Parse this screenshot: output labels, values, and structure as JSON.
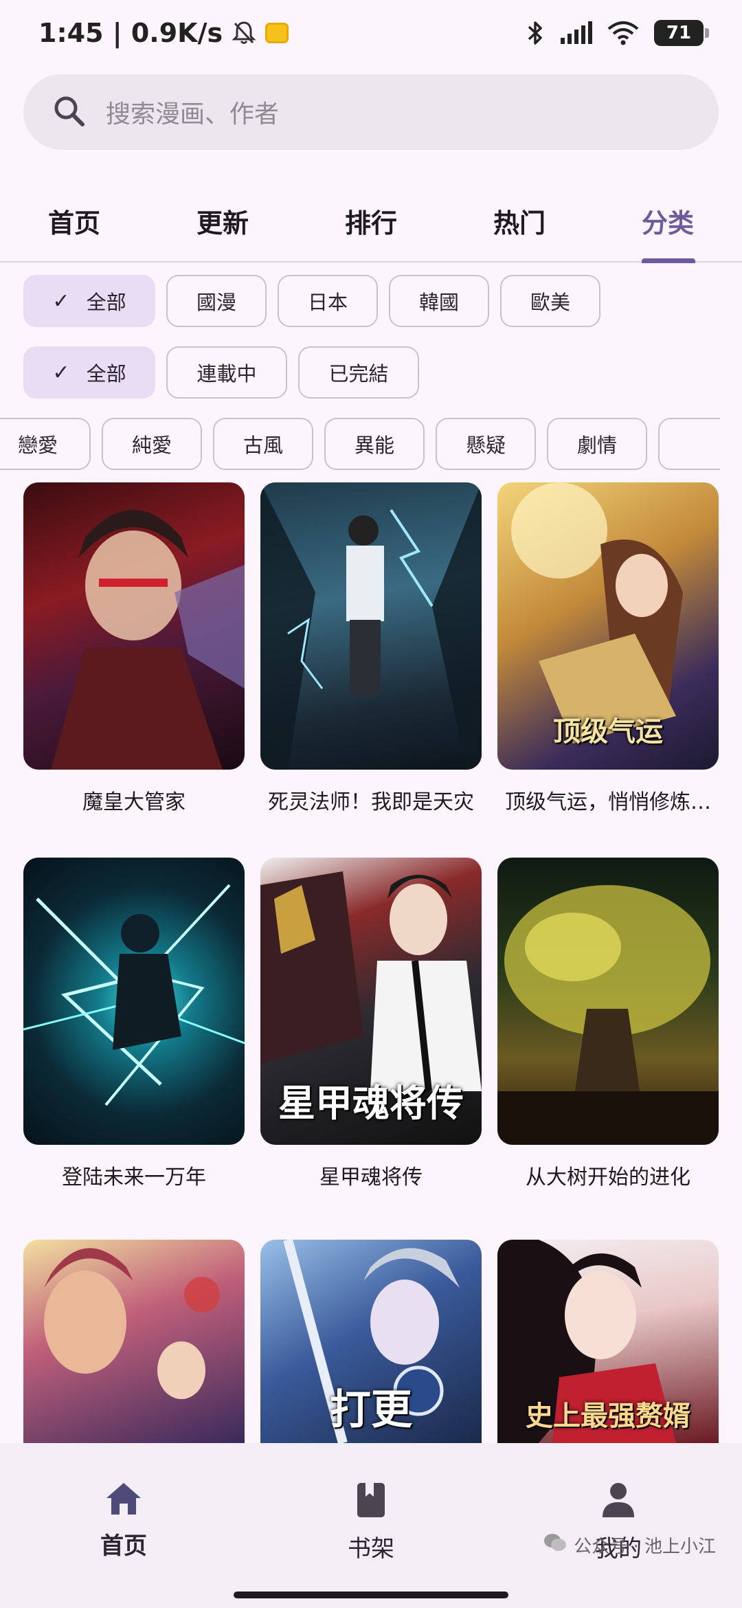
{
  "status_bar": {
    "time_speed": "1:45 | 0.9K/s",
    "battery": "71"
  },
  "search": {
    "placeholder": "搜索漫画、作者"
  },
  "tabs": [
    {
      "label": "首页"
    },
    {
      "label": "更新"
    },
    {
      "label": "排行"
    },
    {
      "label": "热门"
    },
    {
      "label": "分类",
      "active": true
    }
  ],
  "filters": {
    "region": [
      "全部",
      "國漫",
      "日本",
      "韓國",
      "歐美"
    ],
    "status": [
      "全部",
      "連載中",
      "已完結"
    ],
    "genre": [
      "戀愛",
      "純愛",
      "古風",
      "異能",
      "懸疑",
      "劇情"
    ]
  },
  "comics": [
    {
      "title": "魔皇大管家"
    },
    {
      "title": "死灵法师！我即是天灾"
    },
    {
      "title": "顶级气运，悄悄修炼…"
    },
    {
      "title": "登陆未来一万年"
    },
    {
      "title": "星甲魂将传",
      "cover_text": "星甲魂将传"
    },
    {
      "title": "从大树开始的进化"
    },
    {
      "title": ""
    },
    {
      "title": "",
      "cover_text": "打更"
    },
    {
      "title": "",
      "cover_text": "史上最强赘婿"
    }
  ],
  "cover_text_extra": {
    "c3": "顶级气运"
  },
  "bottom_nav": {
    "home": "首页",
    "shelf": "书架",
    "me": "我的"
  },
  "watermark": "公众号 · 池上小江"
}
